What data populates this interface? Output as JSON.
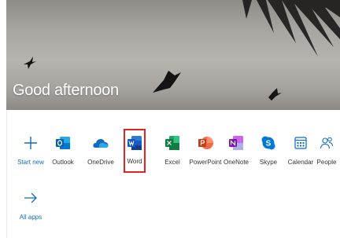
{
  "hero": {
    "greeting": "Good afternoon"
  },
  "apps": [
    {
      "label": "Start new",
      "icon": "plus-icon",
      "color": "#0f6cbd"
    },
    {
      "label": "Outlook",
      "icon": "outlook-icon",
      "color": "#0f6cbd"
    },
    {
      "label": "OneDrive",
      "icon": "onedrive-icon",
      "color": "#0f6cbd"
    },
    {
      "label": "Word",
      "icon": "word-icon",
      "color": "#185abd"
    },
    {
      "label": "Excel",
      "icon": "excel-icon",
      "color": "#107c41"
    },
    {
      "label": "PowerPoint",
      "icon": "powerpoint-icon",
      "color": "#c43e1c"
    },
    {
      "label": "OneNote",
      "icon": "onenote-icon",
      "color": "#7719aa"
    },
    {
      "label": "Skype",
      "icon": "skype-icon",
      "color": "#0078d4"
    },
    {
      "label": "Calendar",
      "icon": "calendar-icon",
      "color": "#0f6cbd"
    },
    {
      "label": "People",
      "icon": "people-icon",
      "color": "#0f6cbd"
    },
    {
      "label": "All apps",
      "icon": "arrow-right-icon",
      "color": "#0f6cbd"
    }
  ],
  "selected_app": "Word"
}
